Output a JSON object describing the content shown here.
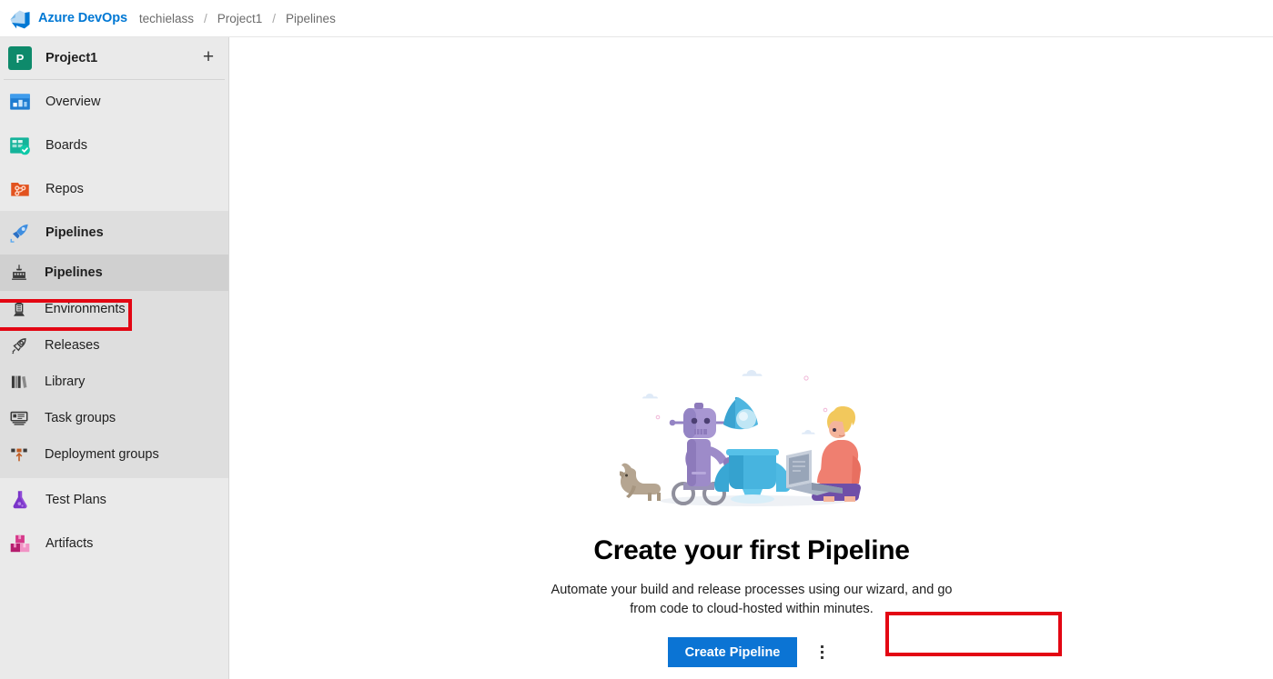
{
  "header": {
    "logo_icon": "azure-devops-logo",
    "brand": "Azure DevOps",
    "separator": "/",
    "breadcrumbs": [
      {
        "label": "techielass"
      },
      {
        "label": "Project1"
      },
      {
        "label": "Pipelines"
      }
    ]
  },
  "sidebar": {
    "project": {
      "avatar_letter": "P",
      "name": "Project1",
      "add_label": "+",
      "add_icon": "plus-icon"
    },
    "nav_items": [
      {
        "label": "Overview",
        "icon": "overview-icon"
      },
      {
        "label": "Boards",
        "icon": "boards-icon"
      },
      {
        "label": "Repos",
        "icon": "repos-icon"
      },
      {
        "label": "Pipelines",
        "icon": "pipelines-icon"
      }
    ],
    "pipelines_sub_items": [
      {
        "label": "Pipelines",
        "icon": "pipeline-factory-icon"
      },
      {
        "label": "Environments",
        "icon": "server-tower-icon"
      },
      {
        "label": "Releases",
        "icon": "rocket-icon"
      },
      {
        "label": "Library",
        "icon": "books-icon"
      },
      {
        "label": "Task groups",
        "icon": "task-list-icon"
      },
      {
        "label": "Deployment groups",
        "icon": "deployment-boxes-icon"
      }
    ],
    "bottom_items": [
      {
        "label": "Test Plans",
        "icon": "test-flask-icon"
      },
      {
        "label": "Artifacts",
        "icon": "artifacts-boxes-icon"
      }
    ]
  },
  "main": {
    "illustration_icon": "robot-rocket-illustration",
    "title": "Create your first Pipeline",
    "subtitle": "Automate your build and release processes using our wizard, and go from code to cloud-hosted within minutes.",
    "create_button_label": "Create Pipeline",
    "more_actions_icon": "kebab-menu-icon"
  },
  "annotations": {
    "color": "#e30613",
    "targets": [
      "sidebar-pipelines-item",
      "create-pipeline-button"
    ]
  },
  "colors": {
    "brand_blue": "#0078d4",
    "button_blue": "#0b74d4",
    "sidebar_bg": "#eaeaea",
    "sidebar_section_bg": "#dedede",
    "sidebar_selected_bg": "#d0d0d0",
    "avatar_green": "#0e8a6b",
    "annotation_red": "#e30613"
  }
}
